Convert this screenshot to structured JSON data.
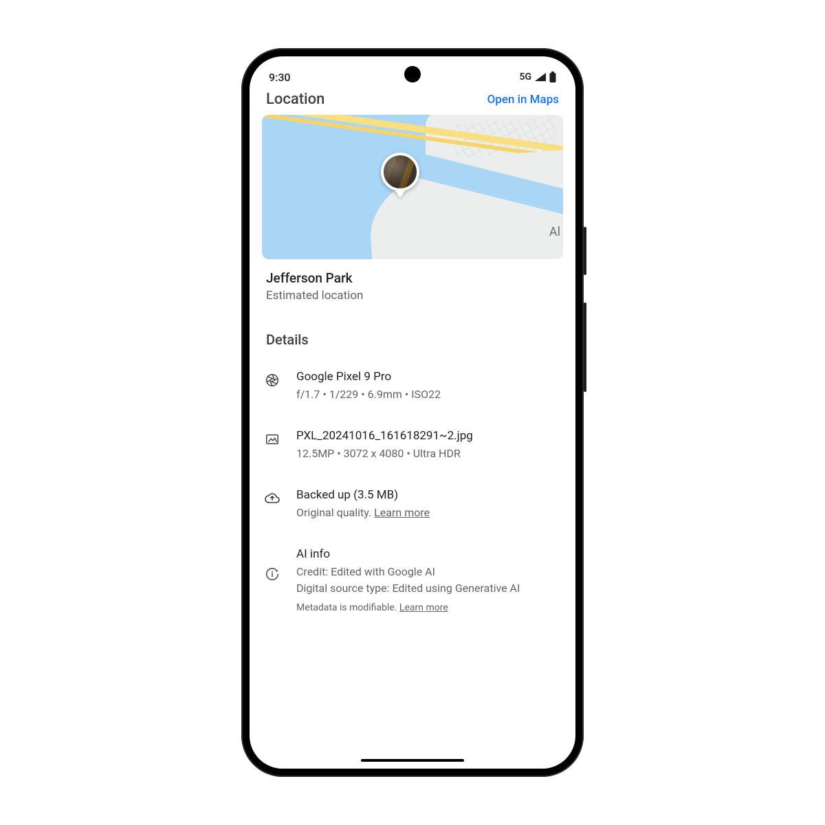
{
  "status": {
    "time": "9:30",
    "network": "5G"
  },
  "header": {
    "title": "Location",
    "open_maps": "Open in Maps"
  },
  "map": {
    "edge_label": "Al"
  },
  "place": {
    "name": "Jefferson Park",
    "sub": "Estimated location"
  },
  "details": {
    "heading": "Details",
    "camera": {
      "device": "Google Pixel 9 Pro",
      "specs": "f/1.7  •  1/229  •  6.9mm  •  ISO22"
    },
    "file": {
      "name": "PXL_20241016_161618291~2.jpg",
      "meta": "12.5MP  •  3072 x 4080  • Ultra HDR"
    },
    "backup": {
      "title": "Backed up (3.5 MB)",
      "quality": "Original quality. ",
      "learn": "Learn more"
    },
    "ai": {
      "title": "AI info",
      "credit": "Credit: Edited with Google AI",
      "source": "Digital source type: Edited using Generative AI",
      "mod": "Metadata is modifiable. ",
      "learn": "Learn more"
    }
  }
}
